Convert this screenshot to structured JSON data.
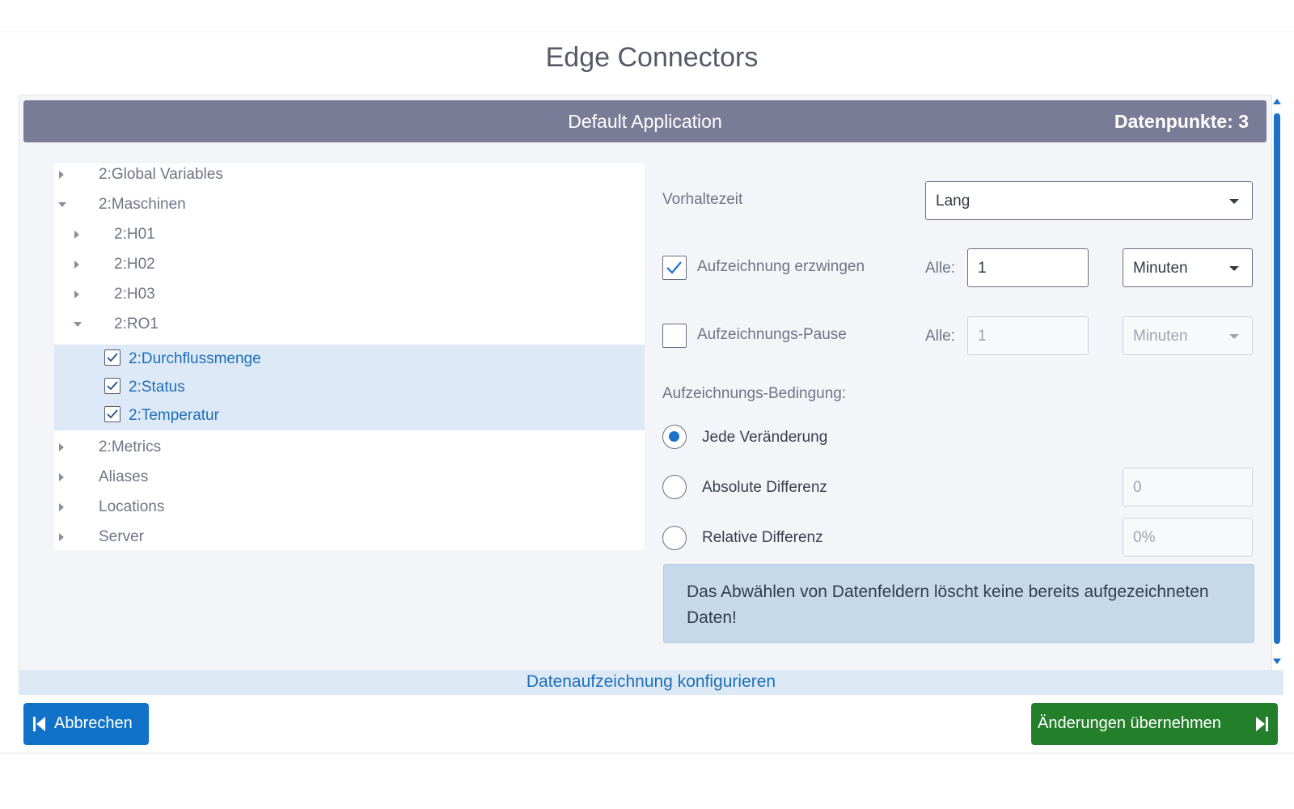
{
  "dialog": {
    "title": "Edge Connectors"
  },
  "app_bar": {
    "title": "Default Application",
    "count": "Datenpunkte: 3"
  },
  "tree": {
    "items": [
      {
        "label": "2:Global Variables",
        "expanded": false
      },
      {
        "label": "2:Maschinen",
        "expanded": true
      },
      {
        "label": "2:H01",
        "expanded": false
      },
      {
        "label": "2:H02",
        "expanded": false
      },
      {
        "label": "2:H03",
        "expanded": false
      },
      {
        "label": "2:RO1",
        "expanded": true
      },
      {
        "label": "2:Durchflussmenge",
        "checked": true
      },
      {
        "label": "2:Status",
        "checked": true
      },
      {
        "label": "2:Temperatur",
        "checked": true
      },
      {
        "label": "2:Metrics",
        "expanded": false
      },
      {
        "label": "Aliases",
        "expanded": false
      },
      {
        "label": "Locations",
        "expanded": false
      },
      {
        "label": "Server",
        "expanded": false
      }
    ]
  },
  "form": {
    "retention_label": "Vorhaltezeit",
    "retention_value": "Lang",
    "force_record_label": "Aufzeichnung erzwingen",
    "force_record_checked": true,
    "force_every_label": "Alle:",
    "force_every_value": "1",
    "force_unit": "Minuten",
    "pause_label": "Aufzeichnungs-Pause",
    "pause_checked": false,
    "pause_every_label": "Alle:",
    "pause_every_value": "1",
    "pause_unit": "Minuten",
    "condition_label": "Aufzeichnungs-Bedingung:",
    "condition_options": [
      {
        "label": "Jede Veränderung",
        "selected": true
      },
      {
        "label": "Absolute Differenz",
        "selected": false,
        "value": "0"
      },
      {
        "label": "Relative Differenz",
        "selected": false,
        "value": "0%"
      }
    ],
    "notice": "Das Abwählen von Datenfeldern löscht keine bereits aufgezeichneten Daten!"
  },
  "footer": {
    "link": "Datenaufzeichnung konfigurieren",
    "cancel_label": "Abbrechen",
    "apply_label": "Änderungen übernehmen"
  },
  "colors": {
    "accent": "#1c72c9",
    "app_bar": "#7a7b96",
    "apply_button": "#247f2b",
    "cancel_button": "#1072c9"
  }
}
